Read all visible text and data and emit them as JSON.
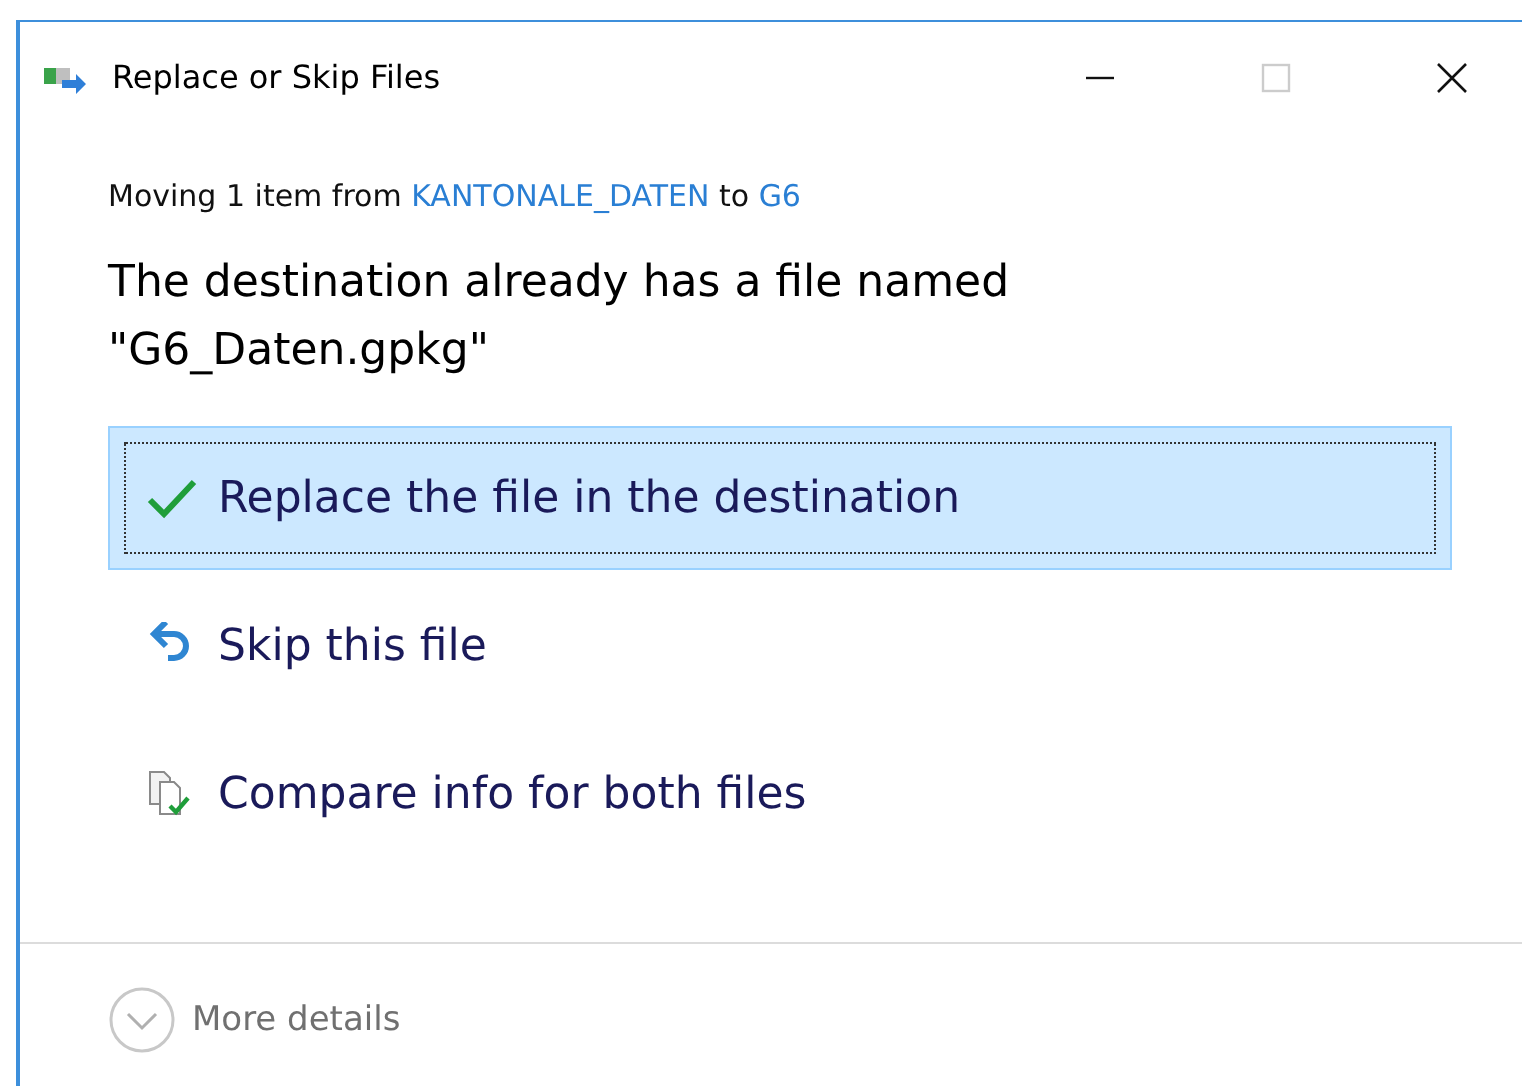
{
  "window": {
    "title": "Replace or Skip Files",
    "controls": [
      {
        "kind": "minimize",
        "disabled": false
      },
      {
        "kind": "maximize",
        "disabled": true
      },
      {
        "kind": "close",
        "disabled": false
      }
    ]
  },
  "status": {
    "prefix": "Moving 1 item from",
    "source": "KANTONALE_DATEN",
    "middle": "to",
    "destination": "G6"
  },
  "heading": "The destination already has a file named \"G6_Daten.gpkg\"",
  "options": [
    {
      "kind": "replace",
      "label": "Replace the file in the destination",
      "selected": true
    },
    {
      "kind": "skip",
      "label": "Skip this file",
      "selected": false
    },
    {
      "kind": "compare",
      "label": "Compare info for both files",
      "selected": false
    }
  ],
  "footer": {
    "label": "More details",
    "expanded": false
  }
}
